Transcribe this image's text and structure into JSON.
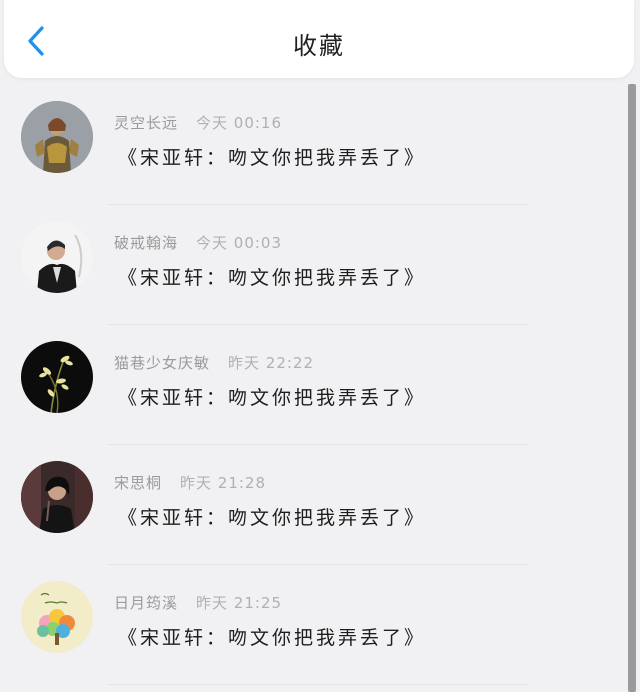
{
  "header": {
    "title": "收藏",
    "back_icon": "chevron-left-icon",
    "accent": "#1f8ff0"
  },
  "items": [
    {
      "user": "灵空长远",
      "time": "今天 00:16",
      "content": "《宋亚轩：吻文你把我弄丢了》",
      "avatar": "armored-warrior-avatar"
    },
    {
      "user": "破戒翰海",
      "time": "今天 00:03",
      "content": "《宋亚轩：吻文你把我弄丢了》",
      "avatar": "man-in-suit-avatar"
    },
    {
      "user": "猫巷少女庆敏",
      "time": "昨天 22:22",
      "content": "《宋亚轩：吻文你把我弄丢了》",
      "avatar": "orchid-flower-avatar"
    },
    {
      "user": "宋思桐",
      "time": "昨天 21:28",
      "content": "《宋亚轩：吻文你把我弄丢了》",
      "avatar": "dark-portrait-avatar"
    },
    {
      "user": "日月筠溪",
      "time": "昨天 21:25",
      "content": "《宋亚轩：吻文你把我弄丢了》",
      "avatar": "colorful-tree-drawing-avatar"
    }
  ]
}
